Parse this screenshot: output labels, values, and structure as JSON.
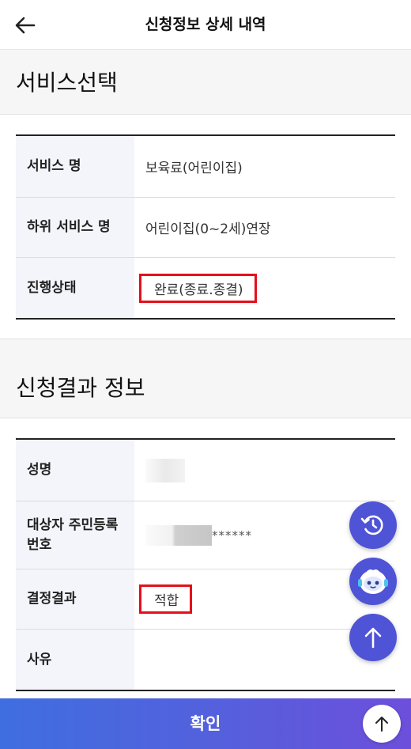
{
  "header": {
    "title": "신청정보 상세 내역"
  },
  "sections": [
    {
      "title": "서비스선택",
      "rows": [
        {
          "label": "서비스 명",
          "value": "보육료(어린이집)"
        },
        {
          "label": "하위 서비스 명",
          "value": "어린이집(0~2세)연장"
        },
        {
          "label": "진행상태",
          "value": "완료(종료.종결)"
        }
      ]
    },
    {
      "title": "신청결과 정보",
      "rows": [
        {
          "label": "성명",
          "value": ""
        },
        {
          "label": "대상자 주민등록 번호",
          "value": "******"
        },
        {
          "label": "결정결과",
          "value": "적합"
        },
        {
          "label": "사유",
          "value": ""
        }
      ]
    }
  ],
  "bottom": {
    "confirm_label": "확인"
  },
  "colors": {
    "accent": "#4f53d6",
    "highlight": "#e3101a"
  },
  "icons": [
    "back-arrow-icon",
    "history-icon",
    "chatbot-icon",
    "arrow-up-icon"
  ]
}
